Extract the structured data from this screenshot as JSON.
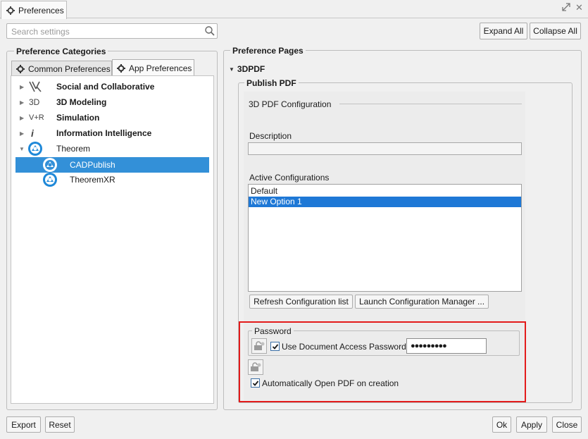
{
  "window": {
    "tab_title": "Preferences",
    "expand_icon": "expand-arrows-icon",
    "close_glyph": "✕"
  },
  "search": {
    "placeholder": "Search settings"
  },
  "toolbar": {
    "expand_all": "Expand All",
    "collapse_all": "Collapse All"
  },
  "left": {
    "title": "Preference Categories",
    "tabs": [
      {
        "label": "Common Preferences",
        "active": false
      },
      {
        "label": "App Preferences",
        "active": true
      }
    ],
    "tree": [
      {
        "label": "Social and Collaborative",
        "icon": "Y",
        "bold": true,
        "expanded": false
      },
      {
        "label": "3D Modeling",
        "icon": "3D",
        "bold": true,
        "expanded": false
      },
      {
        "label": "Simulation",
        "icon": "V+R",
        "bold": true,
        "expanded": false
      },
      {
        "label": "Information Intelligence",
        "icon": "i",
        "bold": true,
        "expanded": false
      },
      {
        "label": "Theorem",
        "icon": "theorem",
        "bold": false,
        "expanded": true
      },
      {
        "label": "CADPublish",
        "icon": "theorem",
        "bold": false,
        "selected": true
      },
      {
        "label": "TheoremXR",
        "icon": "theorem",
        "bold": false
      }
    ]
  },
  "right": {
    "title": "Preference Pages",
    "section": "3DPDF",
    "group": "Publish PDF",
    "config_title": "3D PDF Configuration",
    "description_label": "Description",
    "description_value": "",
    "active_configs_label": "Active Configurations",
    "configs": [
      {
        "label": "Default",
        "selected": false
      },
      {
        "label": "New Option 1",
        "selected": true
      }
    ],
    "refresh_button": "Refresh Configuration list",
    "launch_button": "Launch Configuration Manager ...",
    "password_group": "Password",
    "use_password_label": "Use Document Access Password",
    "use_password_checked": true,
    "password_mask": "●●●●●●●●●",
    "auto_open_label": "Automatically Open PDF on creation",
    "auto_open_checked": true
  },
  "footer": {
    "export": "Export",
    "reset": "Reset",
    "ok": "Ok",
    "apply": "Apply",
    "close": "Close"
  },
  "colors": {
    "selection": "#3390d8",
    "list_selection": "#1e78d6",
    "highlight_border": "#e31b1b",
    "theorem_blue": "#1e88d8"
  }
}
